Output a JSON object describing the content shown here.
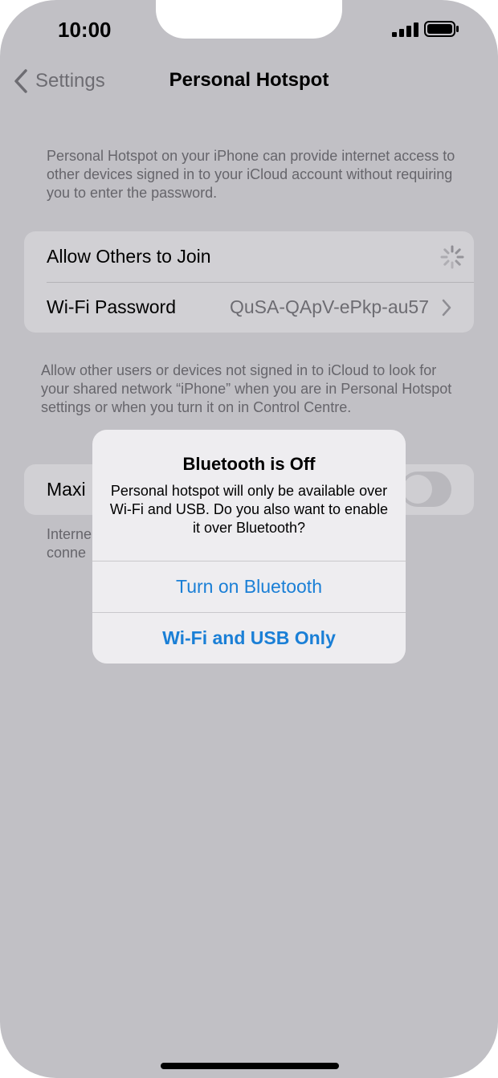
{
  "status_bar": {
    "time": "10:00",
    "icons": [
      "cellular-signal-icon",
      "battery-icon"
    ]
  },
  "nav": {
    "back_label": "Settings",
    "title": "Personal Hotspot"
  },
  "intro_text": "Personal Hotspot on your iPhone can provide internet access to other devices signed in to your iCloud account without requiring you to enter the password.",
  "settings": {
    "allow_others_label": "Allow Others to Join",
    "wifi_password_label": "Wi-Fi Password",
    "wifi_password_value": "QuSA-QApV-ePkp-au57"
  },
  "note_text": "Allow other users or devices not signed in to iCloud to look for your shared network “iPhone” when you are in Personal Hotspot settings or when you turn it on in Control Centre.",
  "maximise": {
    "label_visible": "Maxi",
    "toggle_on": false
  },
  "partial_note": {
    "line1": "Interne",
    "line2": "conne"
  },
  "alert": {
    "title": "Bluetooth is Off",
    "message": "Personal hotspot will only be available over Wi-Fi and USB. Do you also want to enable it over Bluetooth?",
    "primary_button": "Turn on Bluetooth",
    "secondary_button": "Wi-Fi and USB Only"
  },
  "colors": {
    "background": "#c1c0c5",
    "card": "#d1d0d4",
    "alert_bg": "#eeedf0",
    "link_blue": "#1a7fd6"
  }
}
